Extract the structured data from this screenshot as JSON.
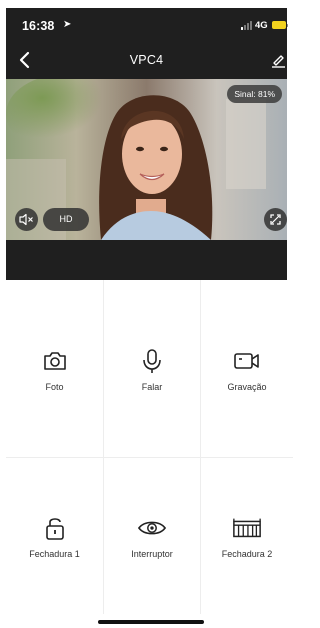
{
  "status_bar": {
    "time": "16:38",
    "location_icon": "location-arrow-icon",
    "network": "4G",
    "battery_color": "#f2d21e"
  },
  "navbar": {
    "title": "VPC4",
    "back_icon": "chevron-left-icon",
    "edit_icon": "pencil-icon"
  },
  "video": {
    "signal_label": "Sinal: 81%",
    "quality_label": "HD",
    "mute_icon": "speaker-muted-icon",
    "fullscreen_icon": "fullscreen-icon"
  },
  "actions": [
    {
      "label": "Foto",
      "icon": "camera-icon"
    },
    {
      "label": "Falar",
      "icon": "microphone-icon"
    },
    {
      "label": "Gravação",
      "icon": "video-camera-icon"
    },
    {
      "label": "Fechadura 1",
      "icon": "padlock-icon"
    },
    {
      "label": "Interruptor",
      "icon": "eye-icon"
    },
    {
      "label": "Fechadura 2",
      "icon": "gate-icon"
    }
  ],
  "colors": {
    "header_bg": "#1f1f1f",
    "badge_bg": "#3c3c3c",
    "icon_color": "#222222"
  }
}
